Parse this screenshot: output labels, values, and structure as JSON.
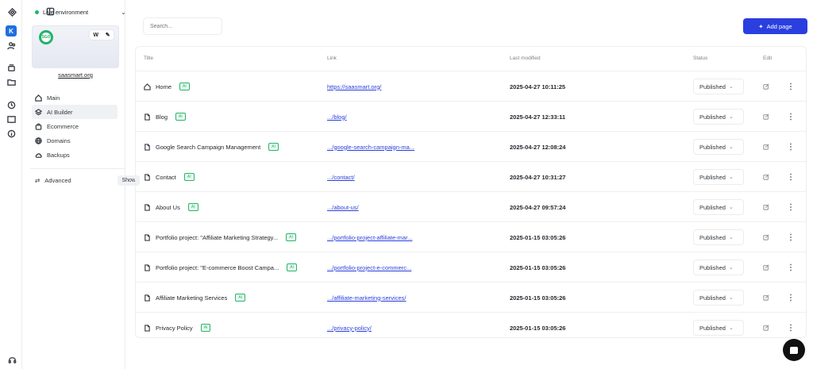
{
  "header": {
    "env_label": "Live environment",
    "env_color": "#21b36b"
  },
  "rail": {
    "workspace_letter": "K"
  },
  "sidebar": {
    "site_name": "saasmart.org",
    "thumb_tool_label": "W",
    "thumb_logo_text": "SGO",
    "nav": [
      {
        "label": "Main",
        "icon": "home-icon"
      },
      {
        "label": "AI Builder",
        "icon": "layers-icon",
        "active": true
      },
      {
        "label": "Ecommerce",
        "icon": "bag-icon"
      },
      {
        "label": "Domains",
        "icon": "globe-icon"
      },
      {
        "label": "Backups",
        "icon": "cloud-icon"
      }
    ],
    "advanced_label": "Advanced",
    "show_label": "Show"
  },
  "main": {
    "search_placeholder": "Search...",
    "add_page_label": "Add page",
    "accent_color": "#2b3ee0",
    "columns": {
      "title": "Title",
      "link": "Link",
      "modified": "Last modified",
      "status": "Status",
      "edit": "Edit"
    },
    "rows": [
      {
        "title": "Home",
        "badge": "AI",
        "link": "https://saasmart.org/",
        "modified": "2025-04-27 10:11:25",
        "status": "Published",
        "icon": "home-icon"
      },
      {
        "title": "Blog",
        "badge": "AI",
        "link": ".../blog/",
        "modified": "2025-04-27 12:33:11",
        "status": "Published",
        "icon": "page-icon"
      },
      {
        "title": "Google Search Campaign Management",
        "badge": "AI",
        "link": ".../google-search-campaign-ma...",
        "modified": "2025-04-27 12:08:24",
        "status": "Published",
        "icon": "page-icon"
      },
      {
        "title": "Contact",
        "badge": "AI",
        "link": ".../contact/",
        "modified": "2025-04-27 10:31:27",
        "status": "Published",
        "icon": "page-icon"
      },
      {
        "title": "About Us",
        "badge": "AI",
        "link": ".../about-us/",
        "modified": "2025-04-27 09:57:24",
        "status": "Published",
        "icon": "page-icon"
      },
      {
        "title": "Portfolio project: \"Affiliate Marketing Strategy...",
        "badge": "AI",
        "link": ".../portfolio-project-affiliate-mar...",
        "modified": "2025-01-15 03:05:26",
        "status": "Published",
        "icon": "page-icon"
      },
      {
        "title": "Portfolio project: \"E-commerce Boost Campa...",
        "badge": "AI",
        "link": ".../portfolio-project-e-commerc...",
        "modified": "2025-01-15 03:05:26",
        "status": "Published",
        "icon": "page-icon"
      },
      {
        "title": "Affiliate Marketing Services",
        "badge": "AI",
        "link": ".../affiliate-marketing-services/",
        "modified": "2025-01-15 03:05:26",
        "status": "Published",
        "icon": "page-icon"
      },
      {
        "title": "Privacy Policy",
        "badge": "AI",
        "link": ".../privacy-policy/",
        "modified": "2025-01-15 03:05:26",
        "status": "Published",
        "icon": "page-icon"
      }
    ]
  }
}
